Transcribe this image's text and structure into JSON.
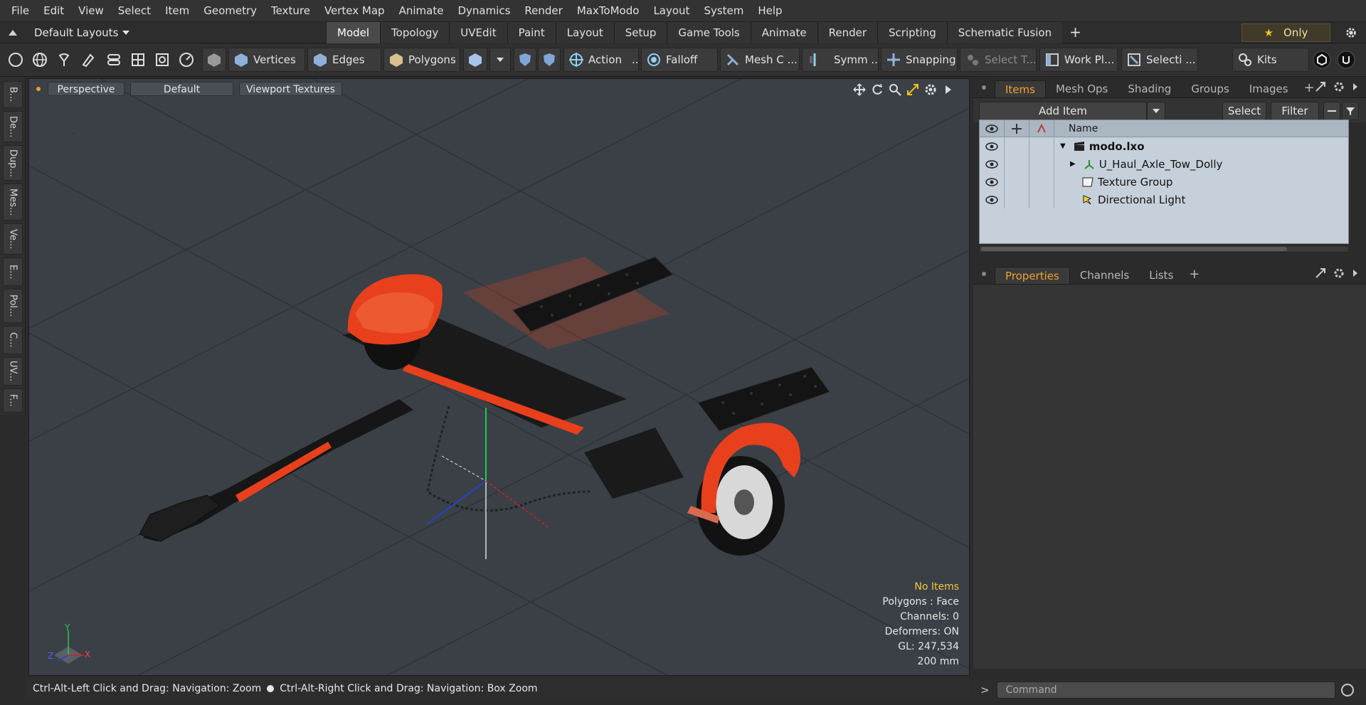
{
  "menu": [
    "File",
    "Edit",
    "View",
    "Select",
    "Item",
    "Geometry",
    "Texture",
    "Vertex Map",
    "Animate",
    "Dynamics",
    "Render",
    "MaxToModo",
    "Layout",
    "System",
    "Help"
  ],
  "layouts": {
    "label": "Default Layouts"
  },
  "tabs": [
    "Model",
    "Topology",
    "UVEdit",
    "Paint",
    "Layout",
    "Setup",
    "Game Tools",
    "Animate",
    "Render",
    "Scripting",
    "Schematic Fusion"
  ],
  "active_tab": "Model",
  "only_label": "Only",
  "toolbar": {
    "vertices": "Vertices",
    "edges": "Edges",
    "polygons": "Polygons",
    "action": "Action",
    "action_more": "...",
    "falloff": "Falloff",
    "mesh": "Mesh C ...",
    "symm": "Symm ...",
    "snapping": "Snapping",
    "select_t": "Select T...",
    "work_plane": "Work Pl...",
    "selection": "Selecti ...",
    "kits": "Kits"
  },
  "left_tabs": [
    "B...",
    "De...",
    "Dup...",
    "Mes...",
    "Ve...",
    "E...",
    "Pol...",
    "C...",
    "UV...",
    "F..."
  ],
  "viewport": {
    "perspective": "Perspective",
    "default": "Default",
    "textures": "Viewport Textures",
    "stats": {
      "no_items": "No Items",
      "polygons": "Polygons : Face",
      "channels": "Channels: 0",
      "deformers": "Deformers: ON",
      "gl": "GL: 247,534",
      "scale": "200 mm"
    },
    "axis_labels": {
      "y": "Y",
      "z": "Z",
      "x": "X"
    }
  },
  "status": {
    "left": "Ctrl-Alt-Left Click and Drag: Navigation: Zoom",
    "right": "Ctrl-Alt-Right Click and Drag: Navigation: Box Zoom"
  },
  "items_panel": {
    "tabs": [
      "Items",
      "Mesh Ops",
      "Shading",
      "Groups",
      "Images"
    ],
    "active": "Items",
    "add_item": "Add Item",
    "select": "Select",
    "filter": "Filter",
    "name_header": "Name",
    "rows": [
      {
        "name": "modo.lxo",
        "bold": true
      },
      {
        "name": "U_Haul_Axle_Tow_Dolly",
        "bold": false
      },
      {
        "name": "Texture Group",
        "bold": false
      },
      {
        "name": "Directional Light",
        "bold": false
      }
    ]
  },
  "props_panel": {
    "tabs": [
      "Properties",
      "Channels",
      "Lists"
    ],
    "active": "Properties"
  },
  "command": {
    "placeholder": "Command",
    "prompt": ">"
  },
  "colors": {
    "accent_orange": "#f0a030",
    "trailer_orange": "#e8401c",
    "viewport_bg": "#3b4046",
    "items_bg": "#c6d0da"
  }
}
